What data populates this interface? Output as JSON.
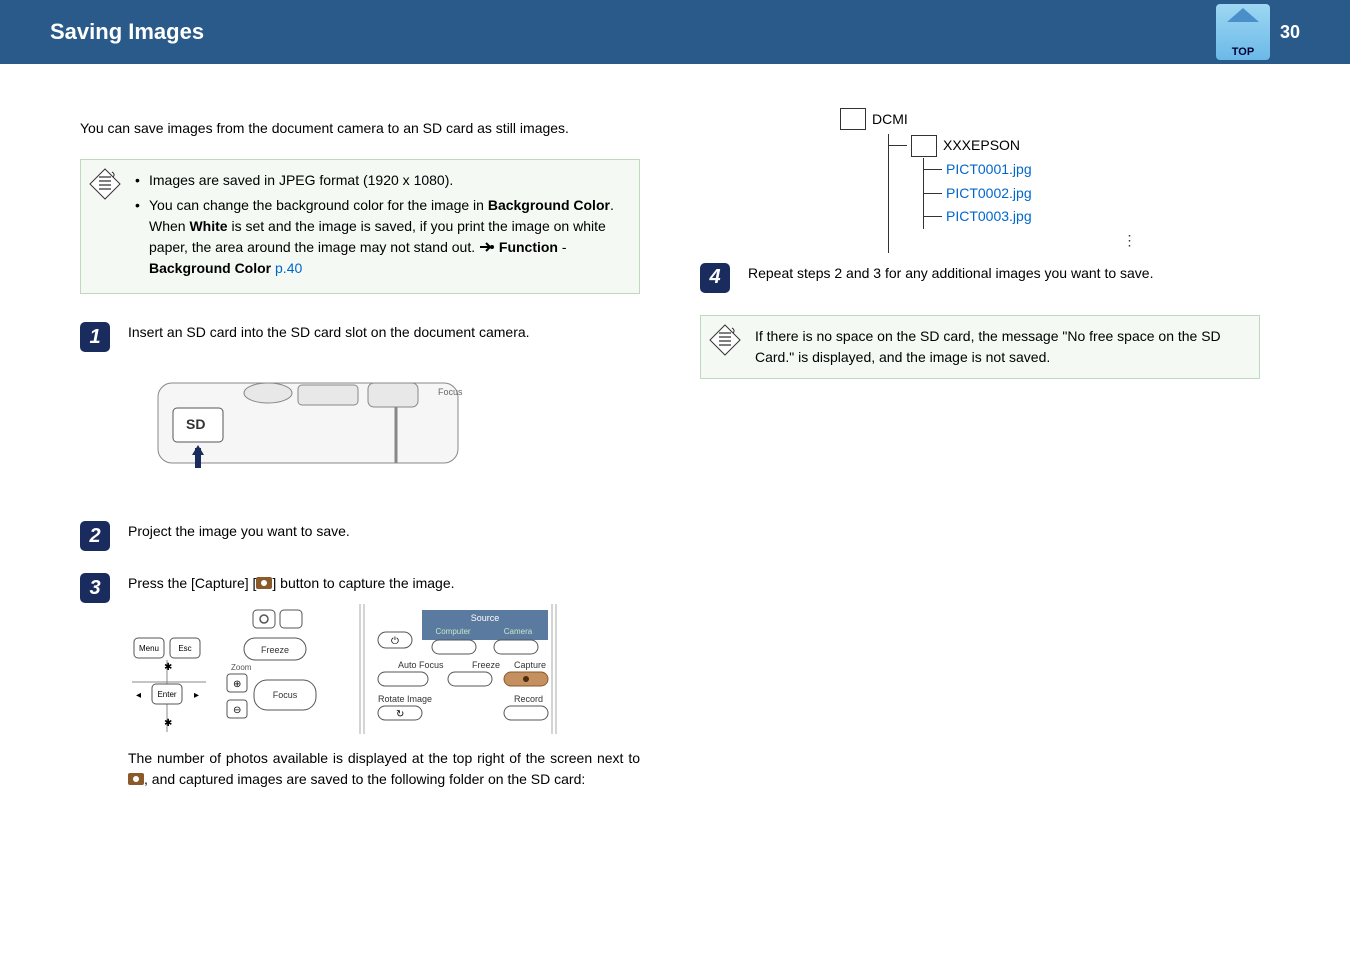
{
  "header": {
    "title": "Saving Images",
    "top_label": "TOP",
    "page_number": "30"
  },
  "intro": "You can save images from the document camera to an SD card as still images.",
  "note1": {
    "bullet1": "Images are saved in JPEG format (1920 x 1080).",
    "bullet2_a": "You can change the background color for the image in ",
    "bullet2_b": "Background Color",
    "bullet2_c": ". When ",
    "bullet2_d": "White",
    "bullet2_e": " is set and the image is saved, if you print the image on white paper, the area around the image may not stand out.  ",
    "bullet2_f": "Function",
    "bullet2_g": " - ",
    "bullet2_h": "Background Color",
    "bullet2_link": "p.40"
  },
  "steps": {
    "s1": {
      "num": "1",
      "text": "Insert an SD card into the SD card slot on the document camera."
    },
    "s2": {
      "num": "2",
      "text": "Project the image you want to save."
    },
    "s3": {
      "num": "3",
      "text_a": "Press the [Capture] [",
      "text_b": "] button to capture the image.",
      "after_a": "The number of photos available is displayed at the top right of the screen next to ",
      "after_b": ", and captured images are saved to the following folder on the SD card:"
    },
    "s4": {
      "num": "4",
      "text": "Repeat steps 2 and 3 for any additional images you want to save."
    }
  },
  "folders": {
    "root": "DCMI",
    "sub": "XXXEPSON",
    "files": [
      "PICT0001.jpg",
      "PICT0002.jpg",
      "PICT0003.jpg"
    ]
  },
  "note2": "If there is no space on the SD card, the message \"No free space on the SD Card.\" is displayed, and the image is not saved.",
  "panel_labels": {
    "menu": "Menu",
    "esc": "Esc",
    "enter": "Enter",
    "freeze": "Freeze",
    "focus": "Focus",
    "zoom": "Zoom",
    "source": "Source",
    "computer": "Computer",
    "camera": "Camera",
    "autofocus": "Auto Focus",
    "capture": "Capture",
    "rotate": "Rotate Image",
    "record": "Record"
  }
}
